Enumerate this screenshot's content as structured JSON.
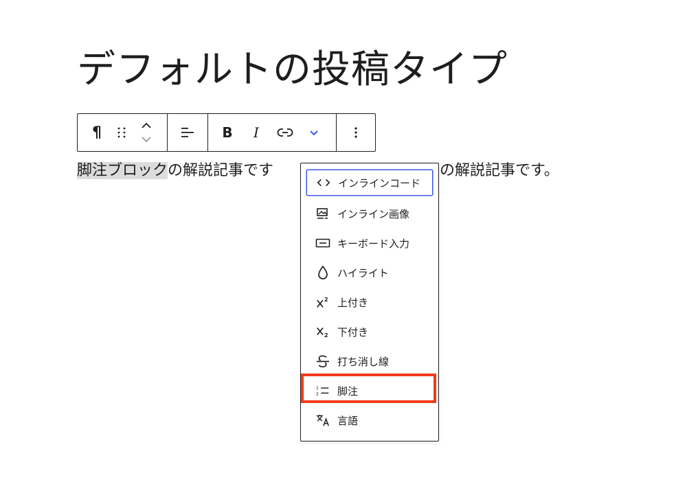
{
  "title": "デフォルトの投稿タイプ",
  "toolbar": {
    "paragraph_glyph": "¶",
    "bold_glyph": "B",
    "italic_glyph": "I"
  },
  "paragraph": {
    "selected": "脚注ブロック",
    "rest": "の解説記事です",
    "tail": "の解説記事です。"
  },
  "menu": {
    "items": [
      {
        "label": "インラインコード",
        "icon": "code-icon"
      },
      {
        "label": "インライン画像",
        "icon": "image-icon"
      },
      {
        "label": "キーボード入力",
        "icon": "keyboard-icon"
      },
      {
        "label": "ハイライト",
        "icon": "highlight-drop-icon"
      },
      {
        "label": "上付き",
        "icon": "superscript-icon"
      },
      {
        "label": "下付き",
        "icon": "subscript-icon"
      },
      {
        "label": "打ち消し線",
        "icon": "strikethrough-icon"
      },
      {
        "label": "脚注",
        "icon": "footnote-icon"
      },
      {
        "label": "言語",
        "icon": "language-icon"
      }
    ]
  },
  "colors": {
    "focus": "#3858e9",
    "highlight_annotation": "#f23a1d",
    "chevron_accent": "#3858e9"
  }
}
